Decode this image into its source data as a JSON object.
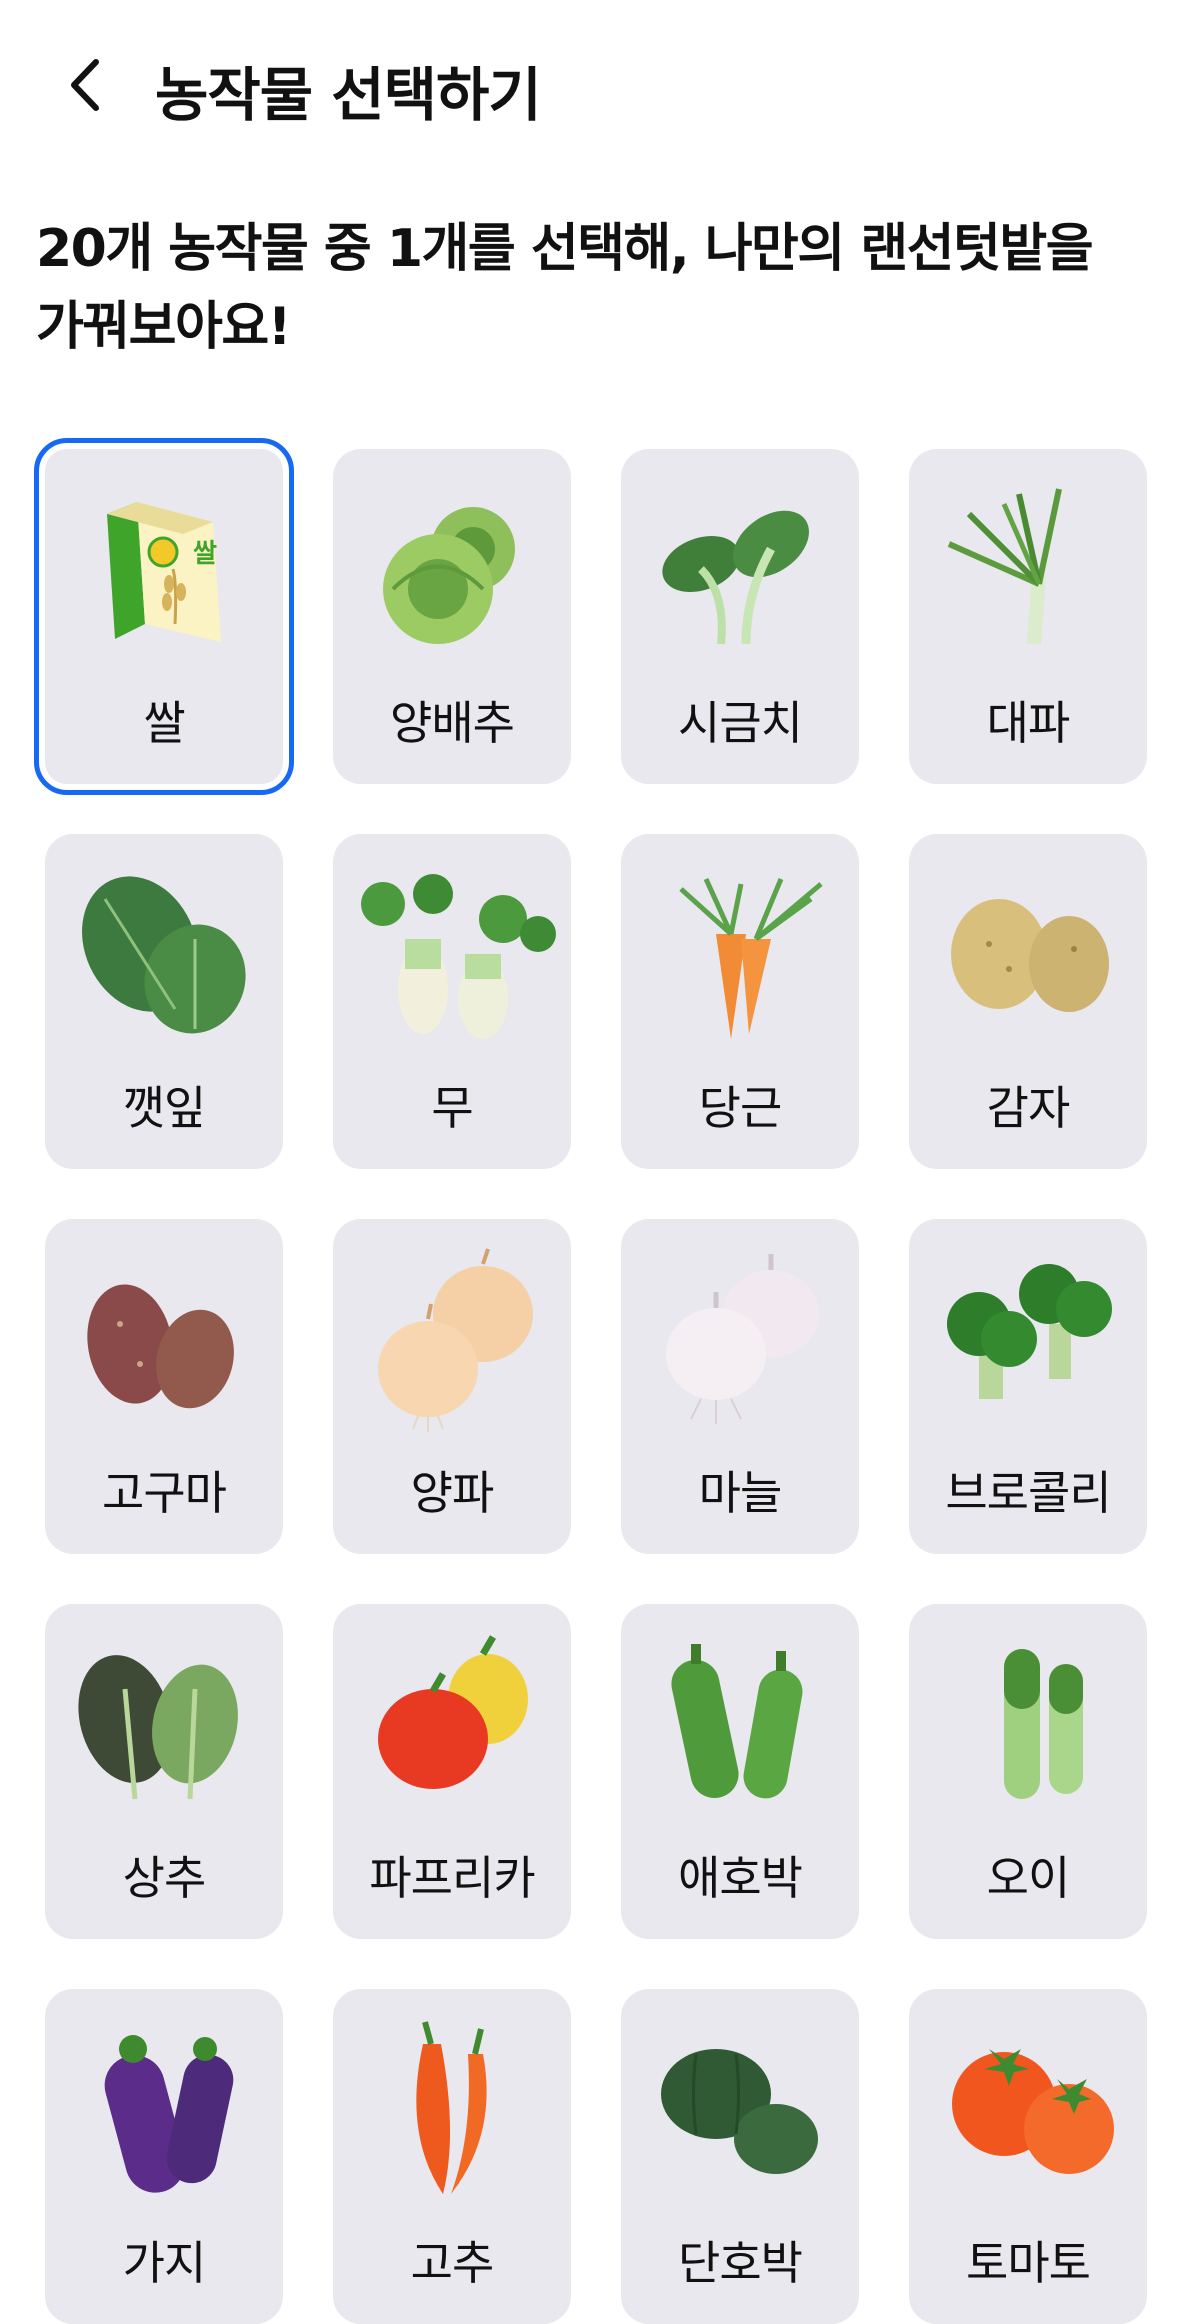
{
  "header": {
    "title": "농작물 선택하기",
    "back_icon": "chevron-left-icon"
  },
  "intro": {
    "line1": "20개 농작물 중 1개를 선택해, 나만의 랜선텃밭을",
    "line2": "가꿔보아요!"
  },
  "selection": {
    "selected_index": 0,
    "selected_border_color": "#1668f5"
  },
  "crops": [
    {
      "label": "쌀",
      "icon": "rice-bag-icon",
      "bag_text": "쌀"
    },
    {
      "label": "양배추",
      "icon": "cabbage-icon"
    },
    {
      "label": "시금치",
      "icon": "spinach-icon"
    },
    {
      "label": "대파",
      "icon": "green-onion-icon"
    },
    {
      "label": "깻잎",
      "icon": "perilla-leaf-icon"
    },
    {
      "label": "무",
      "icon": "radish-icon"
    },
    {
      "label": "당근",
      "icon": "carrot-icon"
    },
    {
      "label": "감자",
      "icon": "potato-icon"
    },
    {
      "label": "고구마",
      "icon": "sweet-potato-icon"
    },
    {
      "label": "양파",
      "icon": "onion-icon"
    },
    {
      "label": "마늘",
      "icon": "garlic-icon"
    },
    {
      "label": "브로콜리",
      "icon": "broccoli-icon"
    },
    {
      "label": "상추",
      "icon": "lettuce-icon"
    },
    {
      "label": "파프리카",
      "icon": "paprika-icon"
    },
    {
      "label": "애호박",
      "icon": "zucchini-icon"
    },
    {
      "label": "오이",
      "icon": "cucumber-icon"
    },
    {
      "label": "가지",
      "icon": "eggplant-icon"
    },
    {
      "label": "고추",
      "icon": "chili-pepper-icon"
    },
    {
      "label": "단호박",
      "icon": "kabocha-squash-icon"
    },
    {
      "label": "토마토",
      "icon": "tomato-icon"
    }
  ]
}
